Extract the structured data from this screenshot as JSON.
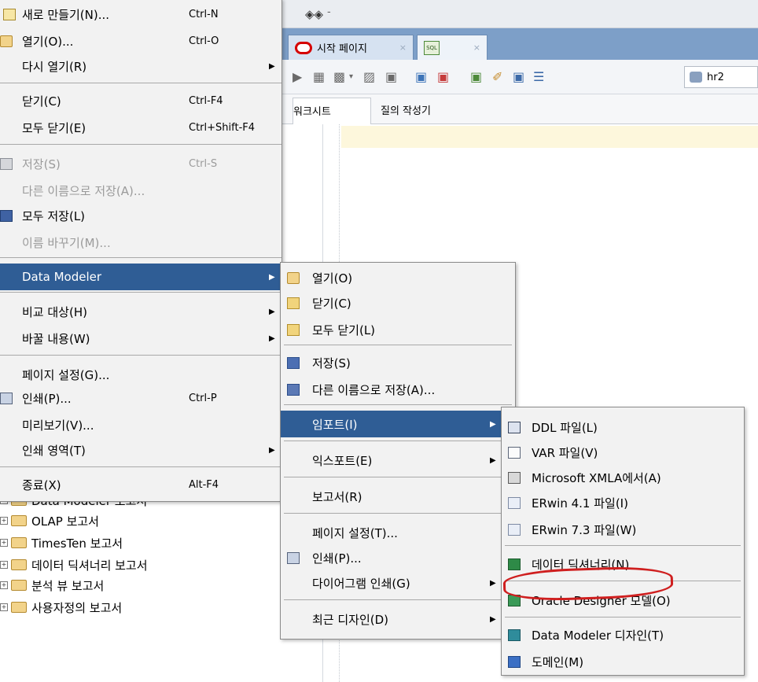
{
  "app": {
    "top_dash": "-",
    "tabs": [
      {
        "label": "시작 페이지",
        "close": "×"
      },
      {
        "label": "",
        "close": "×"
      }
    ],
    "sql_icon_text": "SQL",
    "connection": "hr2",
    "worksheet_tabs": [
      "워크시트",
      "질의 작성기"
    ]
  },
  "tree": {
    "items": [
      {
        "label": "Data Modeler 보고서"
      },
      {
        "label": "OLAP 보고서"
      },
      {
        "label": "TimesTen 보고서"
      },
      {
        "label": "데이터 딕셔너리 보고서"
      },
      {
        "label": "분석 뷰 보고서"
      },
      {
        "label": "사용자정의 보고서"
      }
    ]
  },
  "file_menu": {
    "items": [
      {
        "label": "새로 만들기(N)...",
        "shortcut": "Ctrl-N"
      },
      {
        "label": "열기(O)...",
        "shortcut": "Ctrl-O"
      },
      {
        "label": "다시 열기(R)",
        "shortcut": ""
      },
      {
        "label": "닫기(C)",
        "shortcut": "Ctrl-F4"
      },
      {
        "label": "모두 닫기(E)",
        "shortcut": "Ctrl+Shift-F4"
      },
      {
        "label": "저장(S)",
        "shortcut": "Ctrl-S"
      },
      {
        "label": "다른 이름으로 저장(A)...",
        "shortcut": ""
      },
      {
        "label": "모두 저장(L)",
        "shortcut": ""
      },
      {
        "label": "이름 바꾸기(M)...",
        "shortcut": ""
      },
      {
        "label": "Data Modeler",
        "shortcut": ""
      },
      {
        "label": "비교 대상(H)",
        "shortcut": ""
      },
      {
        "label": "바꿀 내용(W)",
        "shortcut": ""
      },
      {
        "label": "페이지 설정(G)...",
        "shortcut": ""
      },
      {
        "label": "인쇄(P)...",
        "shortcut": "Ctrl-P"
      },
      {
        "label": "미리보기(V)...",
        "shortcut": ""
      },
      {
        "label": "인쇄 영역(T)",
        "shortcut": ""
      },
      {
        "label": "종료(X)",
        "shortcut": "Alt-F4"
      }
    ]
  },
  "dm_menu": {
    "items": [
      {
        "label": "열기(O)"
      },
      {
        "label": "닫기(C)"
      },
      {
        "label": "모두 닫기(L)"
      },
      {
        "label": "저장(S)"
      },
      {
        "label": "다른 이름으로 저장(A)..."
      },
      {
        "label": "임포트(I)"
      },
      {
        "label": "익스포트(E)"
      },
      {
        "label": "보고서(R)"
      },
      {
        "label": "페이지 설정(T)..."
      },
      {
        "label": "인쇄(P)..."
      },
      {
        "label": "다이어그램 인쇄(G)"
      },
      {
        "label": "최근 디자인(D)"
      }
    ]
  },
  "import_menu": {
    "items": [
      {
        "label": "DDL 파일(L)"
      },
      {
        "label": "VAR 파일(V)"
      },
      {
        "label": "Microsoft XMLA에서(A)"
      },
      {
        "label": "ERwin 4.1 파일(I)"
      },
      {
        "label": "ERwin 7.3 파일(W)"
      },
      {
        "label": "데이터 딕셔너리(N)"
      },
      {
        "label": "Oracle Designer 모델(O)"
      },
      {
        "label": "Data Modeler 디자인(T)"
      },
      {
        "label": "도메인(M)"
      }
    ]
  },
  "annotation_color": "#cf1f1f",
  "highlight_color": "#2f5d95"
}
